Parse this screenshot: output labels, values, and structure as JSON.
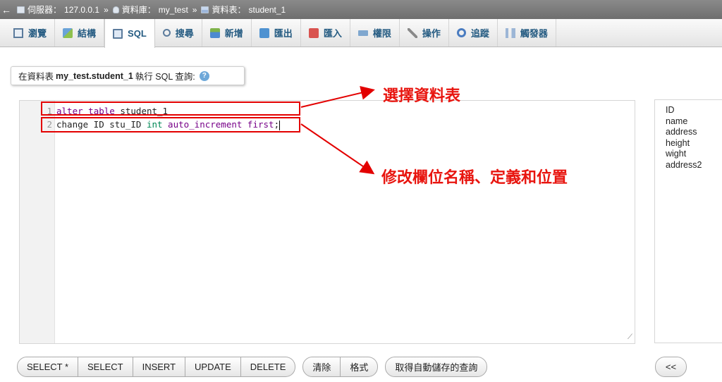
{
  "breadcrumb": {
    "server_label": "伺服器：",
    "server": "127.0.0.1",
    "db_label": "資料庫：",
    "db": "my_test",
    "table_label": "資料表：",
    "table": "student_1",
    "separator": "»"
  },
  "tabs": [
    {
      "label": "瀏覽",
      "icon": "browse-icon"
    },
    {
      "label": "結構",
      "icon": "structure-icon"
    },
    {
      "label": "SQL",
      "icon": "sql-icon",
      "active": true
    },
    {
      "label": "搜尋",
      "icon": "search-icon"
    },
    {
      "label": "新增",
      "icon": "insert-icon"
    },
    {
      "label": "匯出",
      "icon": "export-icon"
    },
    {
      "label": "匯入",
      "icon": "import-icon"
    },
    {
      "label": "權限",
      "icon": "privileges-icon"
    },
    {
      "label": "操作",
      "icon": "operations-icon"
    },
    {
      "label": "追蹤",
      "icon": "tracking-icon"
    },
    {
      "label": "觸發器",
      "icon": "triggers-icon"
    }
  ],
  "query": {
    "legend_prefix": "在資料表",
    "legend_table": "my_test.student_1",
    "legend_suffix": "執行 SQL 查詢:",
    "line1": {
      "num": "1",
      "kw1": "alter",
      "kw2": "table",
      "rest": " student_1"
    },
    "line2": {
      "num": "2",
      "p1": "change ID stu_ID ",
      "type": "int",
      "kw": "auto_increment first",
      "end": ";"
    }
  },
  "annotations": {
    "select_table": "選擇資料表",
    "modify_column": "修改欄位名稱、定義和位置"
  },
  "columns": [
    "ID",
    "name",
    "address",
    "height",
    "wight",
    "address2"
  ],
  "buttons": {
    "select_all": "SELECT *",
    "select": "SELECT",
    "insert": "INSERT",
    "update": "UPDATE",
    "delete": "DELETE",
    "clear": "清除",
    "format": "格式",
    "get_auto_saved": "取得自動儲存的查詢",
    "insert_column": "<<"
  },
  "colors": {
    "annotation": "#e30000",
    "tab_text": "#235a81",
    "keyword": "#770088",
    "type": "#008855"
  }
}
